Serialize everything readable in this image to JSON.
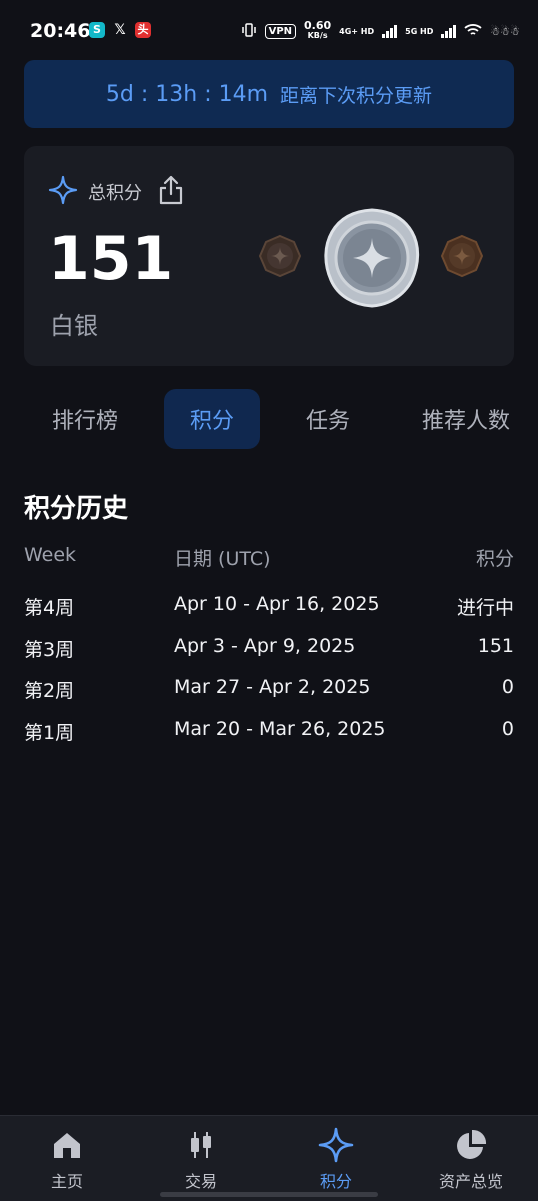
{
  "status_bar": {
    "time": "20:46",
    "vpn": "VPN",
    "speed": "0.60",
    "speed_unit": "KB/s",
    "net1": "4G+ HD",
    "net2": "5G HD"
  },
  "banner": {
    "countdown": "5d : 13h : 14m",
    "text": "距离下次积分更新"
  },
  "points_card": {
    "label": "总积分",
    "total": "151",
    "tier": "白银"
  },
  "tabs": [
    {
      "label": "排行榜",
      "active": false
    },
    {
      "label": "积分",
      "active": true
    },
    {
      "label": "任务",
      "active": false
    },
    {
      "label": "推荐人数",
      "active": false
    }
  ],
  "history": {
    "title": "积分历史",
    "columns": [
      "Week",
      "日期 (UTC)",
      "积分"
    ],
    "rows": [
      {
        "week": "第4周",
        "date": "Apr 10 - Apr 16, 2025",
        "points": "进行中"
      },
      {
        "week": "第3周",
        "date": "Apr 3 - Apr 9, 2025",
        "points": "151"
      },
      {
        "week": "第2周",
        "date": "Mar 27 - Apr 2, 2025",
        "points": "0"
      },
      {
        "week": "第1周",
        "date": "Mar 20 - Mar 26, 2025",
        "points": "0"
      }
    ]
  },
  "bottom_nav": [
    {
      "label": "主页",
      "icon": "home-icon",
      "active": false
    },
    {
      "label": "交易",
      "icon": "candlestick-icon",
      "active": false
    },
    {
      "label": "积分",
      "icon": "sparkle-icon",
      "active": true
    },
    {
      "label": "资产总览",
      "icon": "pie-chart-icon",
      "active": false
    }
  ],
  "colors": {
    "accent": "#5b9cf5",
    "background": "#101117",
    "card": "#1a1c23",
    "banner": "#0f2a52"
  }
}
